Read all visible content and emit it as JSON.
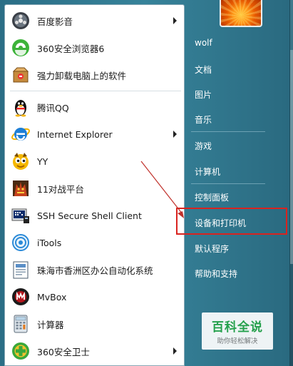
{
  "programs": [
    {
      "label": "百度影音",
      "icon": "baidu-player-icon",
      "submenu": true
    },
    {
      "label": "360安全浏览器6",
      "icon": "360-browser-icon",
      "submenu": false
    },
    {
      "label": "强力卸载电脑上的软件",
      "icon": "uninstall-box-icon",
      "submenu": false
    },
    {
      "label": "腾讯QQ",
      "icon": "qq-penguin-icon",
      "submenu": false
    },
    {
      "label": "Internet Explorer",
      "icon": "ie-icon",
      "submenu": true
    },
    {
      "label": "YY",
      "icon": "yy-icon",
      "submenu": false
    },
    {
      "label": "11对战平台",
      "icon": "11-platform-icon",
      "submenu": false
    },
    {
      "label": "SSH Secure Shell Client",
      "icon": "ssh-client-icon",
      "submenu": false
    },
    {
      "label": "iTools",
      "icon": "itools-icon",
      "submenu": false
    },
    {
      "label": "珠海市香洲区办公自动化系统",
      "icon": "office-system-icon",
      "submenu": false
    },
    {
      "label": "MvBox",
      "icon": "mvbox-icon",
      "submenu": false
    },
    {
      "label": "计算器",
      "icon": "calculator-icon",
      "submenu": false
    },
    {
      "label": "360安全卫士",
      "icon": "360-safe-icon",
      "submenu": true
    }
  ],
  "right_menu": {
    "user": "wolf",
    "documents": "文档",
    "pictures": "图片",
    "music": "音乐",
    "games": "游戏",
    "computer": "计算机",
    "control_panel": "控制面板",
    "devices_printers": "设备和打印机",
    "default_programs": "默认程序",
    "help_support": "帮助和支持"
  },
  "highlight": {
    "target": "devices_printers",
    "color": "#d9231f"
  },
  "watermark": {
    "title": "百科全说",
    "subtitle": "助你轻松解决"
  },
  "colors": {
    "accent": "#2b6e86",
    "highlight_box": "#d9231f",
    "watermark_green": "#25a548"
  }
}
